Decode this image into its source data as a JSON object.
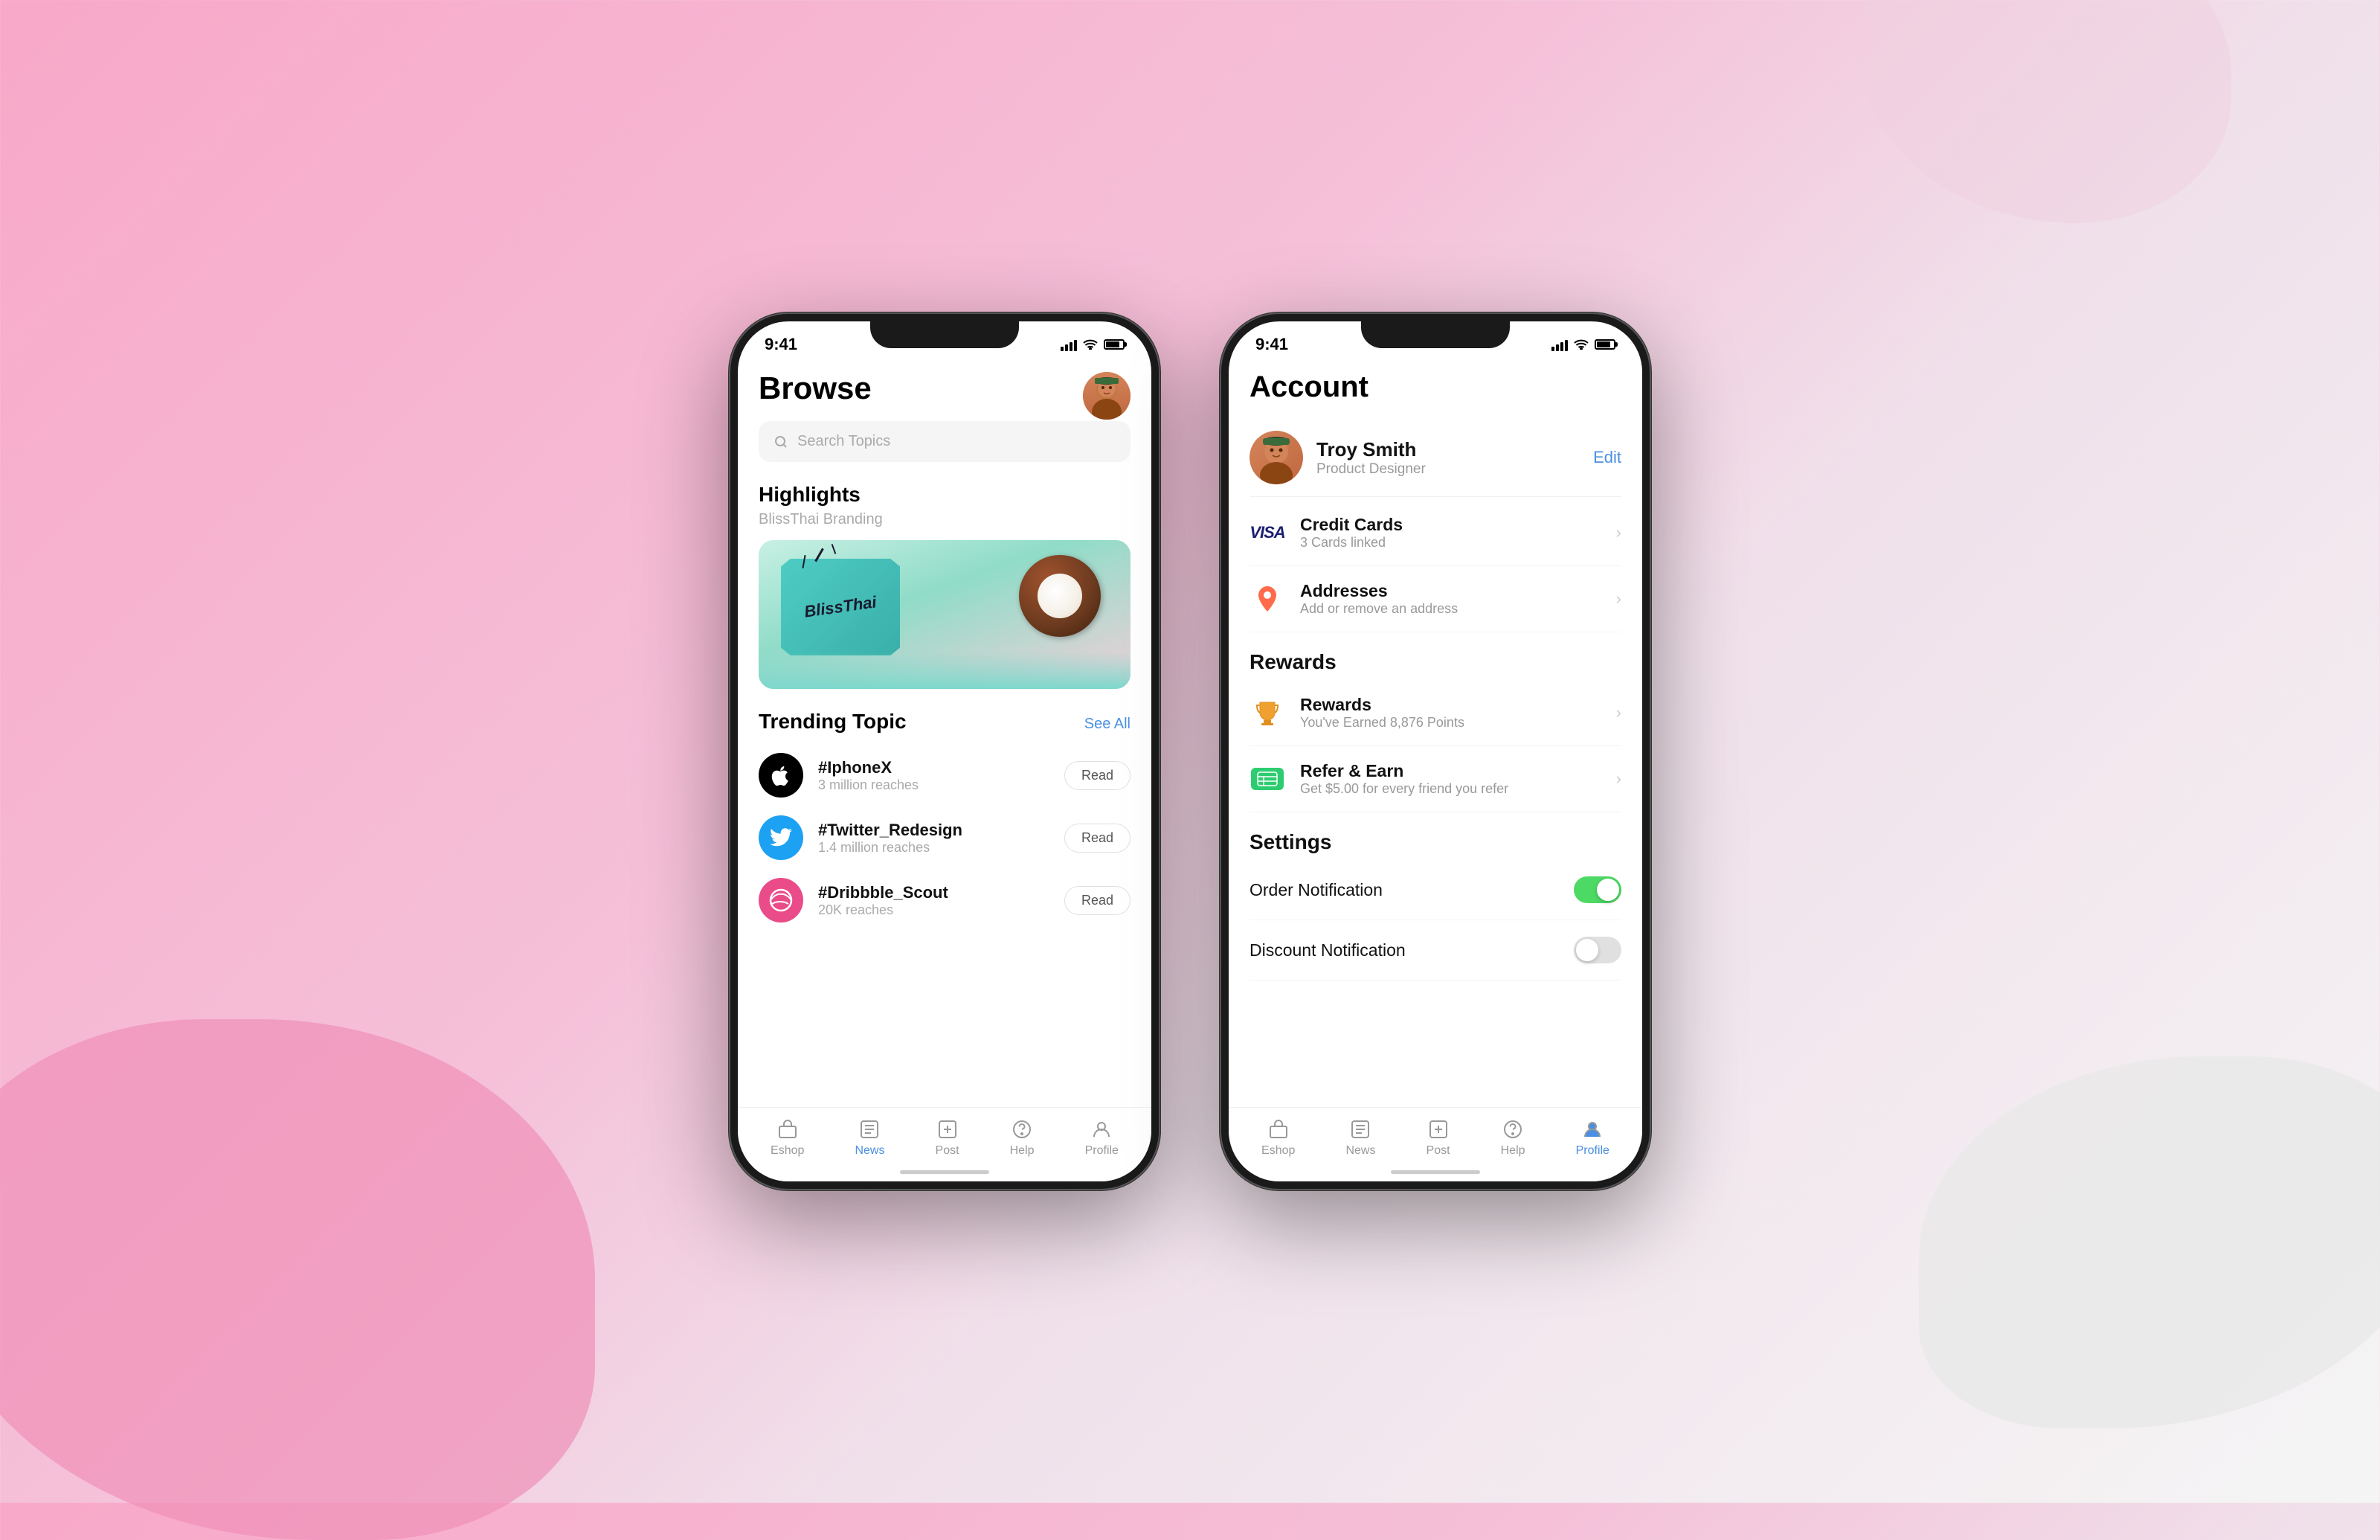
{
  "background": {
    "color_left": "#f090b8",
    "color_right": "#e8e8e8"
  },
  "phone_browse": {
    "status_bar": {
      "time": "9:41"
    },
    "header": {
      "title": "Browse",
      "avatar_alt": "user avatar"
    },
    "search": {
      "placeholder": "Search Topics"
    },
    "highlights": {
      "label": "Highlights",
      "subtitle": "BlissThai Branding"
    },
    "trending": {
      "label": "Trending Topic",
      "see_all": "See All",
      "items": [
        {
          "name": "#IphoneX",
          "reach": "3 million reaches",
          "icon": "apple",
          "read": "Read"
        },
        {
          "name": "#Twitter_Redesign",
          "reach": "1.4 million reaches",
          "icon": "twitter",
          "read": "Read"
        },
        {
          "name": "#Dribbble_Scout",
          "reach": "20K reaches",
          "icon": "dribbble",
          "read": "Read"
        }
      ]
    },
    "bottom_nav": {
      "items": [
        {
          "label": "Eshop",
          "icon": "shop-icon",
          "active": false
        },
        {
          "label": "News",
          "icon": "news-icon",
          "active": true
        },
        {
          "label": "Post",
          "icon": "post-icon",
          "active": false
        },
        {
          "label": "Help",
          "icon": "help-icon",
          "active": false
        },
        {
          "label": "Profile",
          "icon": "profile-icon",
          "active": false
        }
      ]
    }
  },
  "phone_account": {
    "status_bar": {
      "time": "9:41"
    },
    "header": {
      "title": "Account"
    },
    "profile": {
      "name": "Troy Smith",
      "role": "Product Designer",
      "edit_label": "Edit"
    },
    "sections": [
      {
        "title": "",
        "items": [
          {
            "icon": "credit-card-icon",
            "title": "Credit Cards",
            "subtitle": "3 Cards linked",
            "has_chevron": true
          },
          {
            "icon": "location-icon",
            "title": "Addresses",
            "subtitle": "Add or remove an address",
            "has_chevron": true
          }
        ]
      },
      {
        "title": "Rewards",
        "items": [
          {
            "icon": "trophy-icon",
            "title": "Rewards",
            "subtitle": "You've Earned 8,876 Points",
            "has_chevron": true
          },
          {
            "icon": "refer-icon",
            "title": "Refer & Earn",
            "subtitle": "Get $5.00 for every friend you refer",
            "has_chevron": true
          }
        ]
      },
      {
        "title": "Settings",
        "toggles": [
          {
            "label": "Order Notification",
            "on": true
          },
          {
            "label": "Discount Notification",
            "on": false
          }
        ]
      }
    ],
    "bottom_nav": {
      "items": [
        {
          "label": "Eshop",
          "icon": "shop-icon",
          "active": false
        },
        {
          "label": "News",
          "icon": "news-icon",
          "active": false
        },
        {
          "label": "Post",
          "icon": "post-icon",
          "active": false
        },
        {
          "label": "Help",
          "icon": "help-icon",
          "active": false
        },
        {
          "label": "Profile",
          "icon": "profile-icon",
          "active": true
        }
      ]
    }
  }
}
